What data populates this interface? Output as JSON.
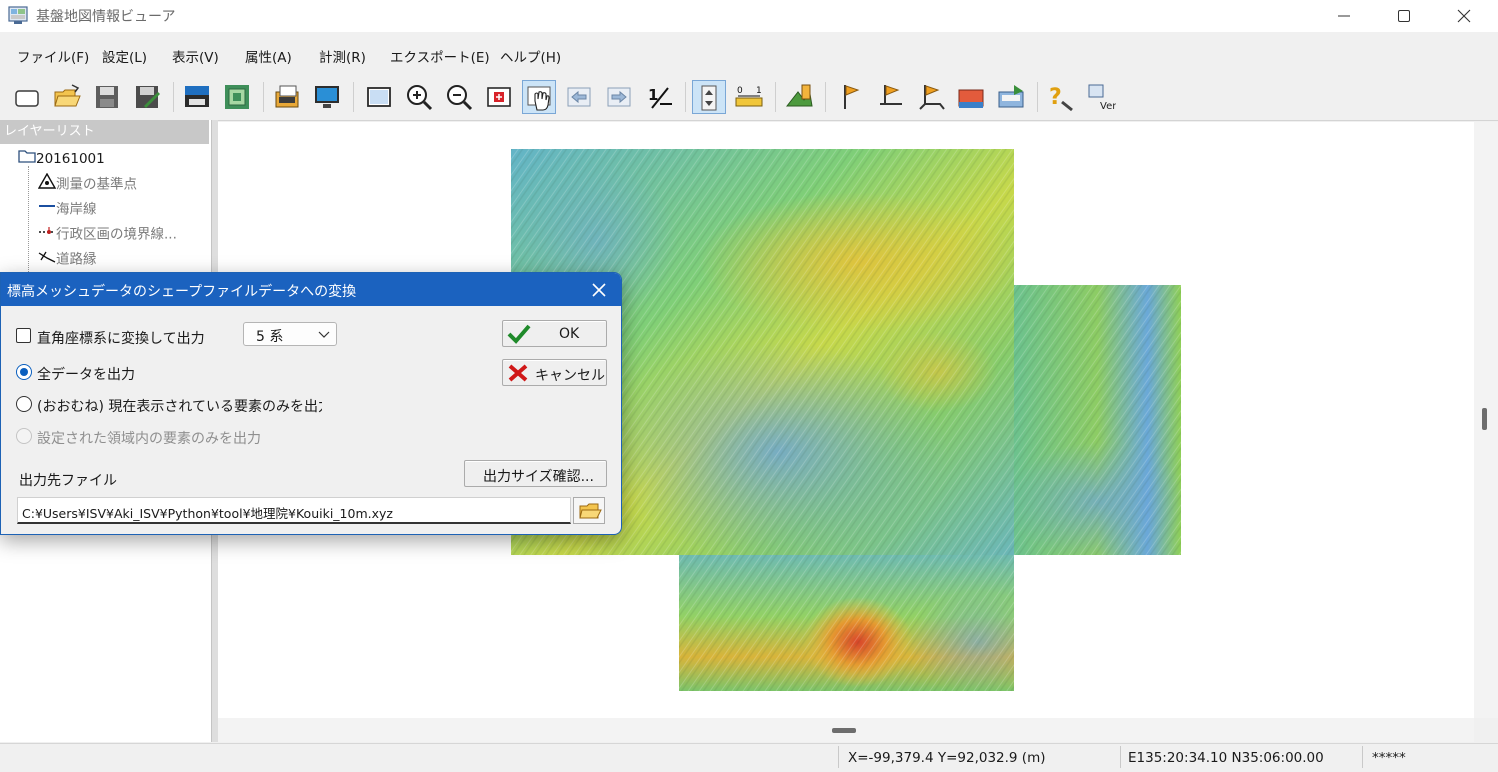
{
  "window": {
    "title": "基盤地図情報ビューア",
    "controls": [
      "minimize-icon",
      "maximize-icon",
      "close-icon"
    ]
  },
  "menu": {
    "items": [
      "ファイル(F)",
      "設定(L)",
      "表示(V)",
      "属性(A)",
      "計測(R)",
      "エクスポート(E)",
      "ヘルプ(H)"
    ]
  },
  "toolbar": {
    "icons": [
      "new-icon",
      "open-folder-icon",
      "save-icon",
      "save-as-icon",
      "print-icon",
      "layer-icon",
      "copy-icon",
      "monitor-icon",
      "full-extent-icon",
      "zoom-in-icon",
      "zoom-out-icon",
      "zoom-box-icon",
      "pan-hand-icon",
      "previous-view-icon",
      "next-view-icon",
      "scale-icon",
      "elevation-mesh-icon",
      "distance-icon",
      "area-icon",
      "flag-icon",
      "flag-line-icon",
      "flag-polygon-icon",
      "profile-icon",
      "export-icon",
      "help-icon",
      "version-icon"
    ]
  },
  "layers": {
    "header": "レイヤーリスト",
    "root": "20161001",
    "items": [
      "測量の基準点",
      "海岸線",
      "行政区画の境界線...",
      "道路縁"
    ]
  },
  "status": {
    "xy": "X=-99,379.4 Y=92,032.9 (m)",
    "latlon": "E135:20:34.10 N35:06:00.00",
    "extra": "*****"
  },
  "dialog": {
    "title": "標高メッシュデータのシェープファイルデータへの変換",
    "checkbox_convert": "直角座標系に変換して出力",
    "zone_select_value": "5 系",
    "radio_all": "全データを出力",
    "radio_visible": "(おおむね) 現在表示されている要素のみを出力",
    "radio_region": "設定された領域内の要素のみを出力",
    "ok_label": "OK",
    "cancel_label": "キャンセル",
    "check_size_label": "出力サイズ確認...",
    "output_file_label": "出力先ファイル",
    "output_path": "C:¥Users¥ISV¥Aki_ISV¥Python¥tool¥地理院¥Kouiki_10m.xyz"
  },
  "colors": {
    "dialog_title_bar": "#1b62bf",
    "radio_selected": "#0a5fbf",
    "map_low": "#6aa3dc",
    "map_mid": "#5fc37a",
    "map_high": "#d96a2e"
  }
}
